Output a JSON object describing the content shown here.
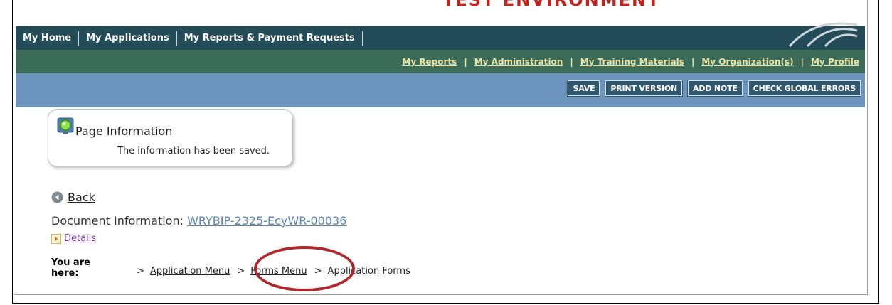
{
  "header": {
    "environment_banner": "TEST ENVIRONMENT"
  },
  "main_nav": {
    "items": [
      {
        "label": "My Home"
      },
      {
        "label": "My Applications"
      },
      {
        "label": "My Reports & Payment Requests"
      }
    ]
  },
  "sub_nav": {
    "items": [
      {
        "label": "My Reports"
      },
      {
        "label": "My Administration"
      },
      {
        "label": "My Training Materials"
      },
      {
        "label": "My Organization(s)"
      },
      {
        "label": "My Profile"
      }
    ]
  },
  "toolbar": {
    "save_label": "SAVE",
    "print_label": "PRINT VERSION",
    "add_note_label": "ADD NOTE",
    "check_errors_label": "CHECK GLOBAL ERRORS"
  },
  "page_info": {
    "title": "Page Information",
    "message": "The information has been saved.",
    "icon": "green-light-icon"
  },
  "back": {
    "label": "Back"
  },
  "document": {
    "label": "Document Information:",
    "id": "WRYBIP-2325-EcyWR-00036"
  },
  "details": {
    "label": "Details"
  },
  "breadcrumb": {
    "prefix": "You are here:",
    "items": [
      {
        "label": "Application Menu"
      },
      {
        "label": "Forms Menu"
      },
      {
        "label": "Application Forms"
      }
    ]
  },
  "colors": {
    "nav_dark": "#244b58",
    "nav_green": "#3b6b59",
    "nav_blue": "#6c94bd",
    "sub_nav_link": "#e9e1a2",
    "button_bg": "#31586f",
    "annotation_red": "#b0282e"
  }
}
